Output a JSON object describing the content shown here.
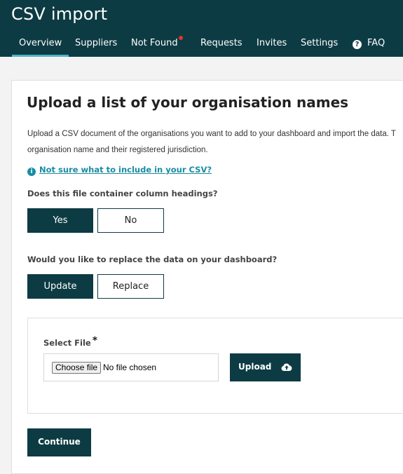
{
  "header": {
    "title": "CSV import",
    "tabs": [
      {
        "label": "Overview"
      },
      {
        "label": "Suppliers"
      },
      {
        "label": "Not Found"
      },
      {
        "label": "Requests"
      },
      {
        "label": "Invites"
      },
      {
        "label": "Settings"
      },
      {
        "label": "FAQ"
      }
    ],
    "faq_icon_glyph": "?",
    "active_color": "#4fb3c6",
    "notification_color": "#e0352b"
  },
  "main": {
    "heading": "Upload a list of your organisation names",
    "description_line1": "Upload a CSV document of the organisations you want to add to your dashboard and import the data. T",
    "description_line2": "organisation name and their registered jurisdiction.",
    "help_link": "Not sure what to include in your CSV?",
    "info_icon_glyph": "i",
    "question_headings": "Does this file container column headings?",
    "yes_label": "Yes",
    "no_label": "No",
    "question_replace": "Would you like to replace the data on your dashboard?",
    "update_label": "Update",
    "replace_label": "Replace",
    "file": {
      "label": "Select File",
      "required_mark": "*",
      "choose_label": "Choose file",
      "status": "No file chosen",
      "upload_label": "Upload"
    },
    "continue_label": "Continue"
  },
  "colors": {
    "brand_dark": "#0d3b44",
    "link": "#1a8ca3"
  }
}
